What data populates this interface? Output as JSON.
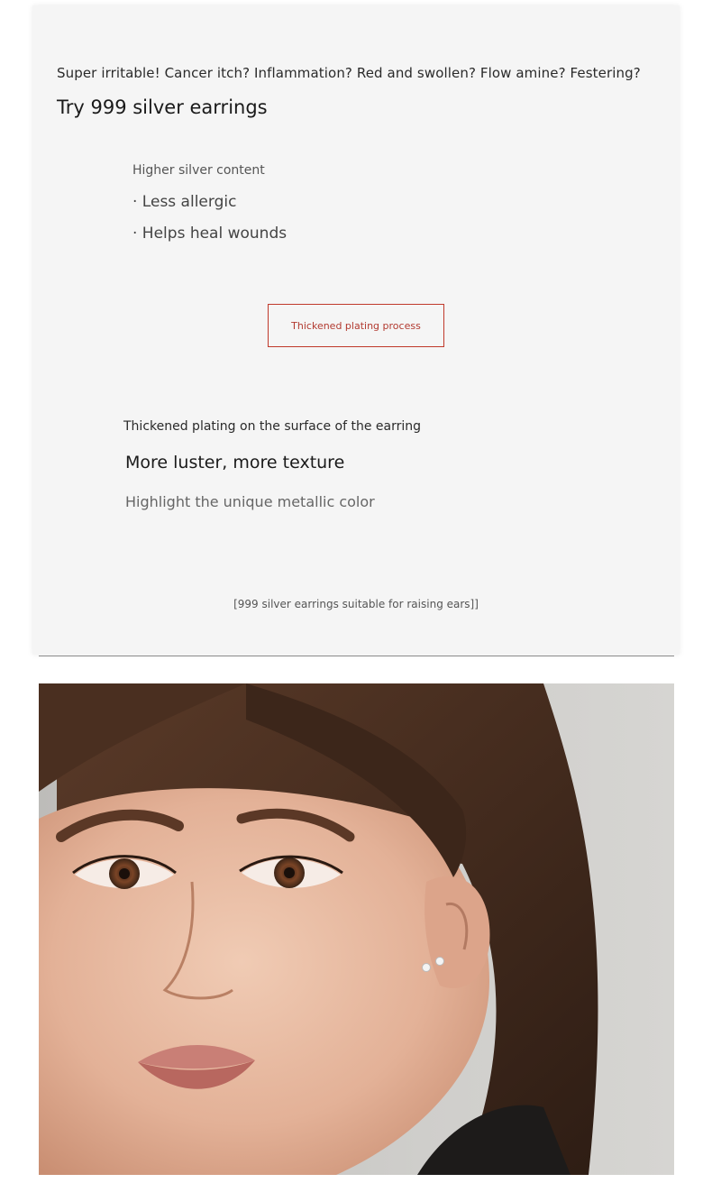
{
  "intro": {
    "symptoms": "Super irritable! Cancer itch? Inflammation? Red and swollen? Flow amine? Festering?",
    "headline": "Try 999 silver earrings"
  },
  "silver_section": {
    "heading": "Higher silver content",
    "bullets": [
      "· Less allergic",
      "· Helps heal wounds"
    ]
  },
  "plating_button": {
    "label": "Thickened plating process",
    "color": "#c0392b"
  },
  "plating_section": {
    "heading": "Thickened plating on the surface of the earring",
    "headline": "More luster, more texture",
    "description": "Highlight the unique metallic color"
  },
  "footnote": "[999 silver earrings suitable for raising ears]]",
  "photo": {
    "subject": "model-wearing-stud-earrings"
  }
}
